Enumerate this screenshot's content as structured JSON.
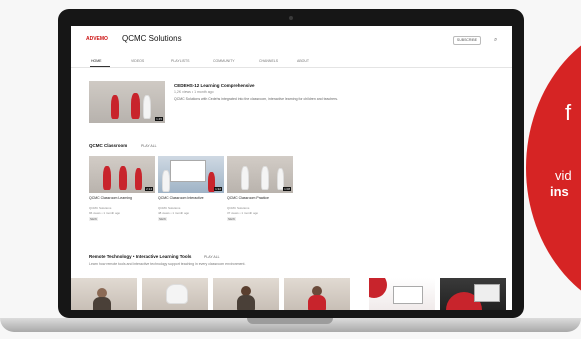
{
  "channel": {
    "logo_text": "ADVEMO",
    "name": "QCMC Solutions",
    "subscribe_label": "SUBSCRIBE",
    "search_icon": "search-icon"
  },
  "tabs": [
    {
      "label": "HOME",
      "active": true
    },
    {
      "label": "VIDEOS",
      "active": false
    },
    {
      "label": "PLAYLISTS",
      "active": false
    },
    {
      "label": "COMMUNITY",
      "active": false
    },
    {
      "label": "CHANNELS",
      "active": false
    },
    {
      "label": "ABOUT",
      "active": false
    }
  ],
  "featured": {
    "title": "CEDEHS-12 Learning Comprehensive",
    "meta": "1,2K views • 1 month ago",
    "description": "QCMC Solutions with Cedehs integrated into the classroom, interactive learning for children and teachers.",
    "duration": "1:45"
  },
  "section1": {
    "title": "QCMC Classroom",
    "play_all": "PLAY ALL",
    "videos": [
      {
        "title": "QCMC Classroom Learning",
        "meta": "QCMC Solutions",
        "views": "96 views • 1 month ago",
        "badge": "NEW",
        "duration": "2:14"
      },
      {
        "title": "QCMC Classroom Interactive",
        "meta": "QCMC Solutions",
        "views": "48 views • 1 month ago",
        "badge": "NEW",
        "duration": "1:32"
      },
      {
        "title": "QCMC Classroom Practice",
        "meta": "QCMC Solutions",
        "views": "37 views • 1 month ago",
        "badge": "NEW",
        "duration": "1:08"
      }
    ]
  },
  "section3": {
    "title": "Remote Technology • Interactive Learning Tools",
    "play_all": "PLAY ALL",
    "description": "Learn how remote tools and interactive technology support teaching in every classroom environment."
  },
  "promo": {
    "fragment_top": "f",
    "fragment_mid": "vid",
    "fragment_bold": "ins"
  },
  "colors": {
    "accent": "#d62424",
    "bezel": "#161616"
  }
}
